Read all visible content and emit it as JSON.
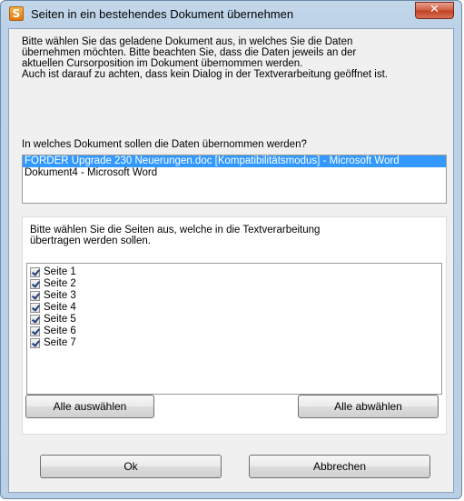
{
  "window": {
    "title": "Seiten in ein bestehendes Dokument übernehmen",
    "app_icon_glyph": "S",
    "close_glyph": "✕"
  },
  "intro_text": "Bitte wählen Sie das geladene Dokument aus, in welches Sie die Daten\nübernehmen möchten.  Bitte beachten Sie, dass die Daten jeweils an der\naktuellen Cursorposition im Dokument übernommen werden.\nAuch ist darauf zu achten, dass kein Dialog in der Textverarbeitung geöffnet ist.",
  "question": "In welches Dokument sollen die Daten übernommen werden?",
  "documents": [
    {
      "label": "FORDER Upgrade 230 Neuerungen.doc [Kompatibilitätsmodus] - Microsoft Word",
      "selected": true
    },
    {
      "label": "Dokument4 - Microsoft Word",
      "selected": false
    }
  ],
  "pages_instruction": "Bitte wählen Sie die Seiten aus, welche in die Textverarbeitung\nübertragen werden sollen.",
  "pages": [
    {
      "label": "Seite 1",
      "checked": true
    },
    {
      "label": "Seite 2",
      "checked": true
    },
    {
      "label": "Seite 3",
      "checked": true
    },
    {
      "label": "Seite 4",
      "checked": true
    },
    {
      "label": "Seite 5",
      "checked": true
    },
    {
      "label": "Seite 6",
      "checked": true
    },
    {
      "label": "Seite 7",
      "checked": true
    }
  ],
  "buttons": {
    "select_all": "Alle auswählen",
    "deselect_all": "Alle abwählen",
    "ok": "Ok",
    "cancel": "Abbrechen"
  },
  "colors": {
    "selection": "#3399ff",
    "title_bar": "#bcd2e8",
    "close_button": "#c2401f"
  }
}
